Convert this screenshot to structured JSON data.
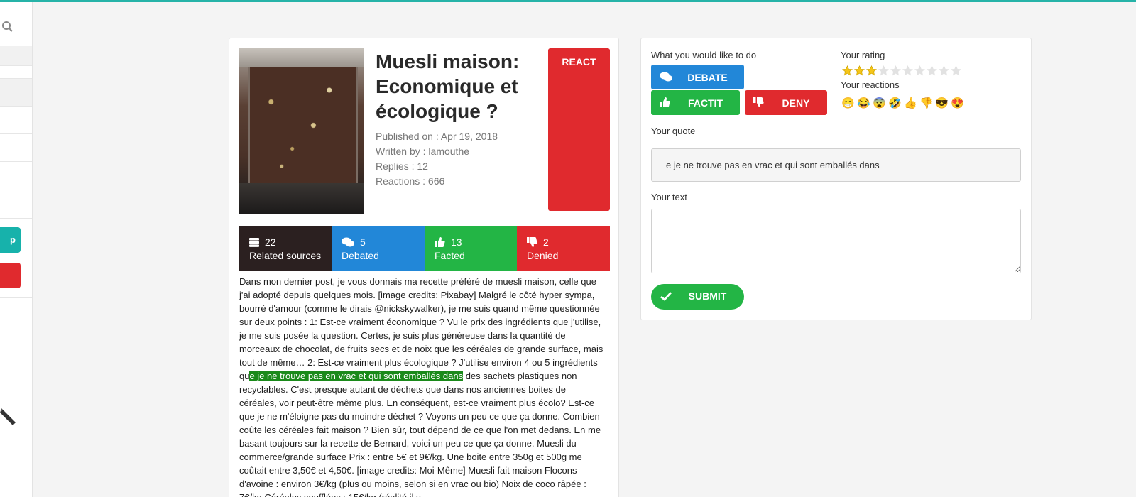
{
  "colors": {
    "accent_teal": "#26b3a8",
    "blue": "#2287d8",
    "green": "#23b545",
    "red": "#e02a2e",
    "dark": "#2b2020",
    "highlight": "#1a8a1a"
  },
  "sidebar": {
    "search_icon": "search-icon",
    "button_1_label": "p",
    "button_2_label": ""
  },
  "article": {
    "title": "Muesli maison: Economique et écologique ?",
    "published": "Published on : Apr 19, 2018",
    "written_by": "Written by : lamouthe",
    "replies": "Replies : 12",
    "reactions": "Reactions : 666",
    "react_label": "REACT",
    "stats": {
      "sources": {
        "count": "22",
        "label": "Related sources",
        "icon": "server-icon"
      },
      "debated": {
        "count": "5",
        "label": "Debated",
        "icon": "comments-icon"
      },
      "facted": {
        "count": "13",
        "label": "Facted",
        "icon": "thumbs-up-icon"
      },
      "denied": {
        "count": "2",
        "label": "Denied",
        "icon": "thumbs-down-icon"
      }
    },
    "body_before": "Dans mon dernier post, je vous donnais ma recette préféré de muesli maison, celle que j'ai adopté depuis quelques mois. [image credits: Pixabay] Malgré le côté hyper sympa, bourré d'amour (comme le dirais @nickskywalker), je me suis quand même questionnée sur deux points : 1: Est-ce vraiment économique ? Vu le prix des ingrédients que j'utilise, je me suis posée la question. Certes, je suis plus généreuse dans la quantité de morceaux de chocolat, de fruits secs et de noix que les céréales de grande surface, mais tout de même… 2: Est-ce vraiment plus écologique ? J'utilise environ 4 ou 5 ingrédients qu",
    "body_highlight": "e je ne trouve pas en vrac et qui sont emballés dans",
    "body_after": " des sachets plastiques non recyclables. C'est presque autant de déchets que dans nos anciennes boites de céréales, voir peut-être même plus. En conséquent, est-ce vraiment plus écolo? Est-ce que je ne m'éloigne pas du moindre déchet ? Voyons un peu ce que ça donne. Combien coûte les céréales fait maison ? Bien sûr, tout dépend de ce que l'on met dedans. En me basant toujours sur la recette de Bernard, voici un peu ce que ça donne. Muesli du commerce/grande surface Prix : entre 5€ et 9€/kg. Une boite entre 350g et 500g me coûtait entre 3,50€ et 4,50€. [image credits: Moi-Même] Muesli fait maison Flocons d'avoine : environ 3€/kg (plus ou moins, selon si en vrac ou bio) Noix de coco râpée : 7€/kg Céréales soufflées : 15€/kg (réalité il y"
  },
  "panel": {
    "todo_label": "What you would like to do",
    "debate_label": "DEBATE",
    "factit_label": "FACTIT",
    "deny_label": "DENY",
    "rating_label": "Your rating",
    "rating": {
      "value": 3,
      "max": 10
    },
    "reactions_label": "Your reactions",
    "reaction_icons": [
      "😁",
      "😂",
      "😨",
      "🤣",
      "👍",
      "👎",
      "😎",
      "😍"
    ],
    "quote_label": "Your quote",
    "quote_value": "e je ne trouve pas en vrac et qui sont emballés dans",
    "text_label": "Your text",
    "text_value": "",
    "submit_label": "SUBMIT"
  }
}
